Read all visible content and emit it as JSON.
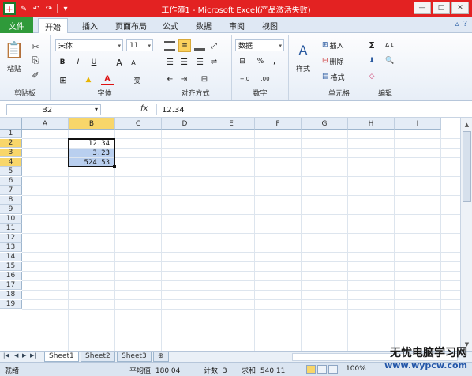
{
  "window": {
    "title": "工作簿1 - Microsoft Excel(产品激活失败)",
    "minimize": "—",
    "restore": "□",
    "close": "✕"
  },
  "qat": {
    "save": "✎",
    "undo": "↶",
    "redo": "↷",
    "more": "▾"
  },
  "tabs": {
    "file": "文件",
    "items": [
      "开始",
      "插入",
      "页面布局",
      "公式",
      "数据",
      "审阅",
      "视图"
    ],
    "active": "开始",
    "help": "?",
    "ribbon_min": "▵"
  },
  "ribbon": {
    "clipboard": {
      "label": "剪贴板",
      "paste": "粘贴",
      "cut": "✂",
      "copy": "⎘",
      "format_painter": "✐"
    },
    "font": {
      "label": "字体",
      "name": "宋体",
      "size": "11",
      "bold": "B",
      "italic": "I",
      "underline": "U",
      "grow": "A",
      "shrink": "A",
      "border": "⊞",
      "fill": "▲",
      "color": "A",
      "phonetic": "变"
    },
    "alignment": {
      "label": "对齐方式"
    },
    "number": {
      "label": "数字",
      "format": "数据",
      "percent": "%",
      "comma": ",",
      "currency": "⊟",
      "inc": "+.0",
      "dec": ".00"
    },
    "styles": {
      "label": "样式",
      "btn": "样式"
    },
    "cells": {
      "label": "单元格",
      "insert": "插入",
      "delete": "删除",
      "format": "格式"
    },
    "editing": {
      "label": "编辑",
      "sum": "Σ",
      "fill": "⬇",
      "clear": "◇",
      "sort": "A↓",
      "find": "🔍"
    }
  },
  "formula_bar": {
    "name_box": "B2",
    "fx": "fx",
    "content": "12.34"
  },
  "grid": {
    "columns": [
      "A",
      "B",
      "C",
      "D",
      "E",
      "F",
      "G",
      "H",
      "I"
    ],
    "selected_column": "B",
    "rows": [
      "1",
      "2",
      "3",
      "4",
      "5",
      "6",
      "7",
      "8",
      "9",
      "10",
      "11",
      "12",
      "13",
      "14",
      "15",
      "16",
      "17",
      "18",
      "19"
    ],
    "selected_rows": [
      "2",
      "3",
      "4"
    ],
    "cells": [
      {
        "ref": "B2",
        "value": "12.34"
      },
      {
        "ref": "B3",
        "value": "3.23"
      },
      {
        "ref": "B4",
        "value": "524.53"
      }
    ]
  },
  "sheets": {
    "tabs": [
      "Sheet1",
      "Sheet2",
      "Sheet3"
    ],
    "active": "Sheet1",
    "new_sheet": "⊕"
  },
  "status": {
    "mode": "就绪",
    "average": "平均值: 180.04",
    "count": "计数: 3",
    "sum": "求和: 540.11",
    "zoom": "100%"
  },
  "watermark": {
    "line1": "无忧电脑学习网",
    "line2": "www.wypcw.com"
  },
  "colors": {
    "titlebar": "#e32222",
    "file_tab": "#2f9a3a",
    "selection": "#b9cfef",
    "header_highlight": "#f8d66a"
  }
}
